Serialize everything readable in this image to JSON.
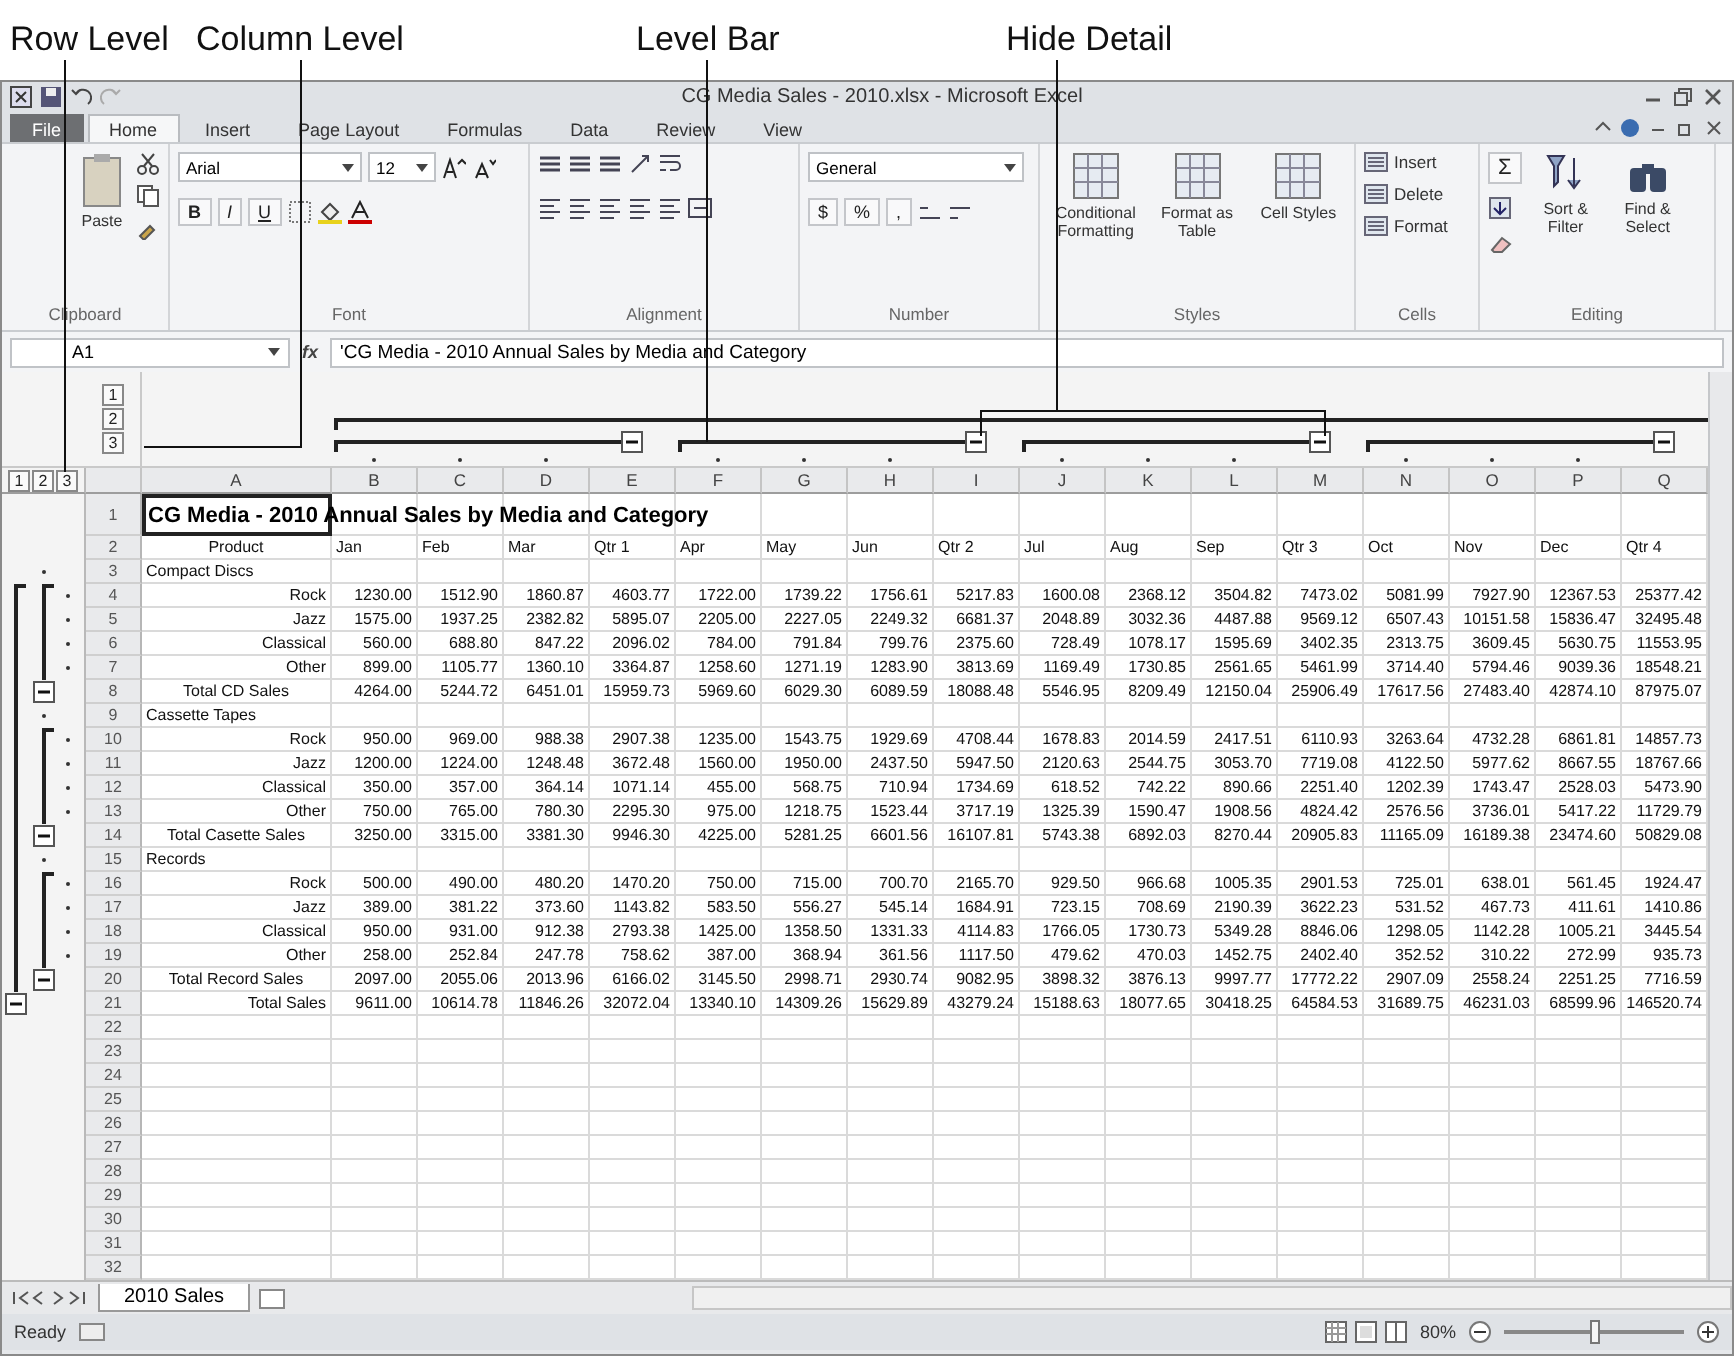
{
  "annotations": [
    {
      "label": "Row Level"
    },
    {
      "label": "Column Level"
    },
    {
      "label": "Level Bar"
    },
    {
      "label": "Hide Detail"
    }
  ],
  "window": {
    "title": "CG Media Sales - 2010.xlsx  -  Microsoft Excel"
  },
  "ribbon": {
    "tabs": [
      {
        "label": "File",
        "kind": "file",
        "selected": false
      },
      {
        "label": "Home",
        "kind": "tab",
        "selected": true
      },
      {
        "label": "Insert",
        "kind": "tab",
        "selected": false
      },
      {
        "label": "Page Layout",
        "kind": "tab",
        "selected": false
      },
      {
        "label": "Formulas",
        "kind": "tab",
        "selected": false
      },
      {
        "label": "Data",
        "kind": "tab",
        "selected": false
      },
      {
        "label": "Review",
        "kind": "tab",
        "selected": false
      },
      {
        "label": "View",
        "kind": "tab",
        "selected": false
      }
    ],
    "clipboard": {
      "group": "Clipboard",
      "paste": "Paste"
    },
    "font": {
      "group": "Font",
      "name": "Arial",
      "size": "12",
      "bold": "B",
      "italic": "I",
      "underline": "U"
    },
    "alignment": {
      "group": "Alignment"
    },
    "number": {
      "group": "Number",
      "format": "General",
      "currency": "$",
      "percent": "%",
      "comma": ","
    },
    "styles": {
      "group": "Styles",
      "buttons": [
        "Conditional Formatting",
        "Format as Table",
        "Cell Styles"
      ]
    },
    "cells": {
      "group": "Cells",
      "buttons": [
        "Insert",
        "Delete",
        "Format"
      ]
    },
    "editing": {
      "group": "Editing",
      "sigma": "Σ",
      "buttons": [
        "Sort & Filter",
        "Find & Select"
      ]
    }
  },
  "formula_bar": {
    "name_box": "A1",
    "fx": "fx",
    "formula": "'CG Media - 2010 Annual Sales by Media and Category"
  },
  "sheet": {
    "row_levels": [
      "1",
      "2",
      "3"
    ],
    "column_levels": [
      "1",
      "2",
      "3"
    ],
    "columns": [
      "A",
      "B",
      "C",
      "D",
      "E",
      "F",
      "G",
      "H",
      "I",
      "J",
      "K",
      "L",
      "M",
      "N",
      "O",
      "P",
      "Q"
    ],
    "column_groups": [
      {
        "expanded": true
      },
      {
        "expanded": true
      },
      {
        "expanded": true
      },
      {
        "expanded": true
      }
    ],
    "rows": [
      {
        "number": "1",
        "kind": "title",
        "cells": [
          "CG Media - 2010 Annual Sales by Media and Category"
        ]
      },
      {
        "number": "2",
        "kind": "header",
        "cells": [
          "Product",
          "Jan",
          "Feb",
          "Mar",
          "Qtr 1",
          "Apr",
          "May",
          "Jun",
          "Qtr 2",
          "Jul",
          "Aug",
          "Sep",
          "Qtr 3",
          "Oct",
          "Nov",
          "Dec",
          "Qtr 4"
        ]
      },
      {
        "number": "3",
        "kind": "group",
        "cells": [
          "Compact Discs"
        ]
      },
      {
        "number": "4",
        "kind": "detail",
        "cells": [
          "Rock",
          "1230.00",
          "1512.90",
          "1860.87",
          "4603.77",
          "1722.00",
          "1739.22",
          "1756.61",
          "5217.83",
          "1600.08",
          "2368.12",
          "3504.82",
          "7473.02",
          "5081.99",
          "7927.90",
          "12367.53",
          "25377.42"
        ]
      },
      {
        "number": "5",
        "kind": "detail",
        "cells": [
          "Jazz",
          "1575.00",
          "1937.25",
          "2382.82",
          "5895.07",
          "2205.00",
          "2227.05",
          "2249.32",
          "6681.37",
          "2048.89",
          "3032.36",
          "4487.88",
          "9569.12",
          "6507.43",
          "10151.58",
          "15836.47",
          "32495.48"
        ]
      },
      {
        "number": "6",
        "kind": "detail",
        "cells": [
          "Classical",
          "560.00",
          "688.80",
          "847.22",
          "2096.02",
          "784.00",
          "791.84",
          "799.76",
          "2375.60",
          "728.49",
          "1078.17",
          "1595.69",
          "3402.35",
          "2313.75",
          "3609.45",
          "5630.75",
          "11553.95"
        ]
      },
      {
        "number": "7",
        "kind": "detail",
        "cells": [
          "Other",
          "899.00",
          "1105.77",
          "1360.10",
          "3364.87",
          "1258.60",
          "1271.19",
          "1283.90",
          "3813.69",
          "1169.49",
          "1730.85",
          "2561.65",
          "5461.99",
          "3714.40",
          "5794.46",
          "9039.36",
          "18548.21"
        ]
      },
      {
        "number": "8",
        "kind": "subtotal",
        "expanded": true,
        "cells": [
          "Total CD Sales",
          "4264.00",
          "5244.72",
          "6451.01",
          "15959.73",
          "5969.60",
          "6029.30",
          "6089.59",
          "18088.48",
          "5546.95",
          "8209.49",
          "12150.04",
          "25906.49",
          "17617.56",
          "27483.40",
          "42874.10",
          "87975.07"
        ]
      },
      {
        "number": "9",
        "kind": "group",
        "cells": [
          "Cassette Tapes"
        ]
      },
      {
        "number": "10",
        "kind": "detail",
        "cells": [
          "Rock",
          "950.00",
          "969.00",
          "988.38",
          "2907.38",
          "1235.00",
          "1543.75",
          "1929.69",
          "4708.44",
          "1678.83",
          "2014.59",
          "2417.51",
          "6110.93",
          "3263.64",
          "4732.28",
          "6861.81",
          "14857.73"
        ]
      },
      {
        "number": "11",
        "kind": "detail",
        "cells": [
          "Jazz",
          "1200.00",
          "1224.00",
          "1248.48",
          "3672.48",
          "1560.00",
          "1950.00",
          "2437.50",
          "5947.50",
          "2120.63",
          "2544.75",
          "3053.70",
          "7719.08",
          "4122.50",
          "5977.62",
          "8667.55",
          "18767.66"
        ]
      },
      {
        "number": "12",
        "kind": "detail",
        "cells": [
          "Classical",
          "350.00",
          "357.00",
          "364.14",
          "1071.14",
          "455.00",
          "568.75",
          "710.94",
          "1734.69",
          "618.52",
          "742.22",
          "890.66",
          "2251.40",
          "1202.39",
          "1743.47",
          "2528.03",
          "5473.90"
        ]
      },
      {
        "number": "13",
        "kind": "detail",
        "cells": [
          "Other",
          "750.00",
          "765.00",
          "780.30",
          "2295.30",
          "975.00",
          "1218.75",
          "1523.44",
          "3717.19",
          "1325.39",
          "1590.47",
          "1908.56",
          "4824.42",
          "2576.56",
          "3736.01",
          "5417.22",
          "11729.79"
        ]
      },
      {
        "number": "14",
        "kind": "subtotal",
        "expanded": true,
        "cells": [
          "Total Casette Sales",
          "3250.00",
          "3315.00",
          "3381.30",
          "9946.30",
          "4225.00",
          "5281.25",
          "6601.56",
          "16107.81",
          "5743.38",
          "6892.03",
          "8270.44",
          "20905.83",
          "11165.09",
          "16189.38",
          "23474.60",
          "50829.08"
        ]
      },
      {
        "number": "15",
        "kind": "group",
        "cells": [
          "Records"
        ]
      },
      {
        "number": "16",
        "kind": "detail",
        "cells": [
          "Rock",
          "500.00",
          "490.00",
          "480.20",
          "1470.20",
          "750.00",
          "715.00",
          "700.70",
          "2165.70",
          "929.50",
          "966.68",
          "1005.35",
          "2901.53",
          "725.01",
          "638.01",
          "561.45",
          "1924.47"
        ]
      },
      {
        "number": "17",
        "kind": "detail",
        "cells": [
          "Jazz",
          "389.00",
          "381.22",
          "373.60",
          "1143.82",
          "583.50",
          "556.27",
          "545.14",
          "1684.91",
          "723.15",
          "708.69",
          "2190.39",
          "3622.23",
          "531.52",
          "467.73",
          "411.61",
          "1410.86"
        ]
      },
      {
        "number": "18",
        "kind": "detail",
        "cells": [
          "Classical",
          "950.00",
          "931.00",
          "912.38",
          "2793.38",
          "1425.00",
          "1358.50",
          "1331.33",
          "4114.83",
          "1766.05",
          "1730.73",
          "5349.28",
          "8846.06",
          "1298.05",
          "1142.28",
          "1005.21",
          "3445.54"
        ]
      },
      {
        "number": "19",
        "kind": "detail",
        "cells": [
          "Other",
          "258.00",
          "252.84",
          "247.78",
          "758.62",
          "387.00",
          "368.94",
          "361.56",
          "1117.50",
          "479.62",
          "470.03",
          "1452.75",
          "2402.40",
          "352.52",
          "310.22",
          "272.99",
          "935.73"
        ]
      },
      {
        "number": "20",
        "kind": "subtotal",
        "expanded": true,
        "cells": [
          "Total Record Sales",
          "2097.00",
          "2055.06",
          "2013.96",
          "6166.02",
          "3145.50",
          "2998.71",
          "2930.74",
          "9082.95",
          "3898.32",
          "3876.13",
          "9997.77",
          "17772.22",
          "2907.09",
          "2558.24",
          "2251.25",
          "7716.59"
        ]
      },
      {
        "number": "21",
        "kind": "total",
        "expanded": true,
        "cells": [
          "Total Sales",
          "9611.00",
          "10614.78",
          "11846.26",
          "32072.04",
          "13340.10",
          "14309.26",
          "15629.89",
          "43279.24",
          "15188.63",
          "18077.65",
          "30418.25",
          "64584.53",
          "31689.75",
          "46231.03",
          "68599.96",
          "146520.74"
        ]
      },
      {
        "number": "22",
        "kind": "blank",
        "cells": []
      },
      {
        "number": "23",
        "kind": "blank",
        "cells": []
      },
      {
        "number": "24",
        "kind": "blank",
        "cells": []
      },
      {
        "number": "25",
        "kind": "blank",
        "cells": []
      },
      {
        "number": "26",
        "kind": "blank",
        "cells": []
      },
      {
        "number": "27",
        "kind": "blank",
        "cells": []
      },
      {
        "number": "28",
        "kind": "blank",
        "cells": []
      },
      {
        "number": "29",
        "kind": "blank",
        "cells": []
      },
      {
        "number": "30",
        "kind": "blank",
        "cells": []
      },
      {
        "number": "31",
        "kind": "blank",
        "cells": []
      },
      {
        "number": "32",
        "kind": "blank",
        "cells": []
      }
    ]
  },
  "sheet_tabs": [
    {
      "label": "2010 Sales",
      "selected": true
    }
  ],
  "status_bar": {
    "text": "Ready",
    "zoom": "80%",
    "zoom_slider": {
      "level": 0.5
    }
  }
}
